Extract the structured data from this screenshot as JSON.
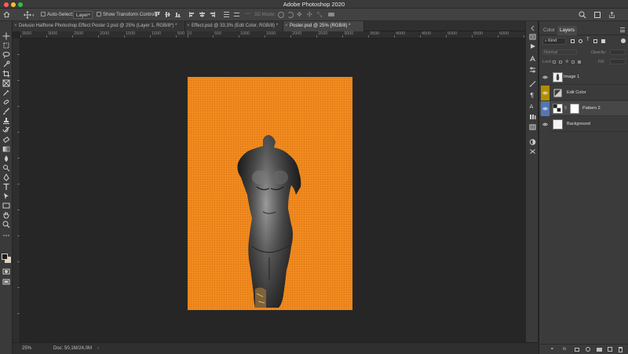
{
  "window": {
    "title": "Adobe Photoshop 2020"
  },
  "traffic_lights": [
    {
      "name": "close",
      "color": "#ff5f57"
    },
    {
      "name": "minimize",
      "color": "#febc2e"
    },
    {
      "name": "maximize",
      "color": "#28c840"
    }
  ],
  "options_bar": {
    "auto_select_label": "Auto-Select:",
    "auto_select_target": "Layer",
    "show_transform_label": "Show Transform Controls",
    "mode_3d_label": "3D Mode:"
  },
  "tabs": [
    {
      "label": "Delusio Halftone Photoshop Effect Poster 2.psd @ 25% (Layer 1, RGB/8*) *",
      "active": false
    },
    {
      "label": "Effect.psd @ 33,3% (Edit Color, RGB/8) *",
      "active": false
    },
    {
      "label": "Poster.psd @ 25% (RGB/8) *",
      "active": true
    }
  ],
  "ruler_labels": [
    "3500",
    "3000",
    "2500",
    "2000",
    "1500",
    "1000",
    "500",
    "0",
    "500",
    "1000",
    "1500",
    "2000",
    "2500",
    "3000",
    "3500",
    "4000",
    "4500",
    "5000",
    "5500",
    "6000"
  ],
  "canvas": {
    "background_color": "#f08a1f"
  },
  "status_bar": {
    "zoom": "25%",
    "doc_info": "Doc: 50,1M/24,0M"
  },
  "panel": {
    "tabs": [
      {
        "label": "Color",
        "active": false
      },
      {
        "label": "Layers",
        "active": true
      }
    ],
    "filter_label": "Kind",
    "blend_mode": "Normal",
    "opacity_label": "Opacity:",
    "lock_label": "Lock:",
    "fill_label": "Fill:",
    "layers": [
      {
        "name": "Image 1",
        "eye_color": "#3b3b3b",
        "thumb": "image"
      },
      {
        "name": "Edit Color",
        "eye_color": "#b08e00",
        "thumb": "adjustment"
      },
      {
        "name": "Pattern 2",
        "eye_color": "#5476b6",
        "thumb": "pattern"
      },
      {
        "name": "Background",
        "eye_color": "#3b3b3b",
        "thumb": "white"
      }
    ],
    "footer_icons": [
      "link-icon",
      "fx-icon",
      "mask-icon",
      "adjustment-icon",
      "group-icon",
      "new-layer-icon",
      "trash-icon"
    ],
    "footer_fx_label": "fx"
  }
}
